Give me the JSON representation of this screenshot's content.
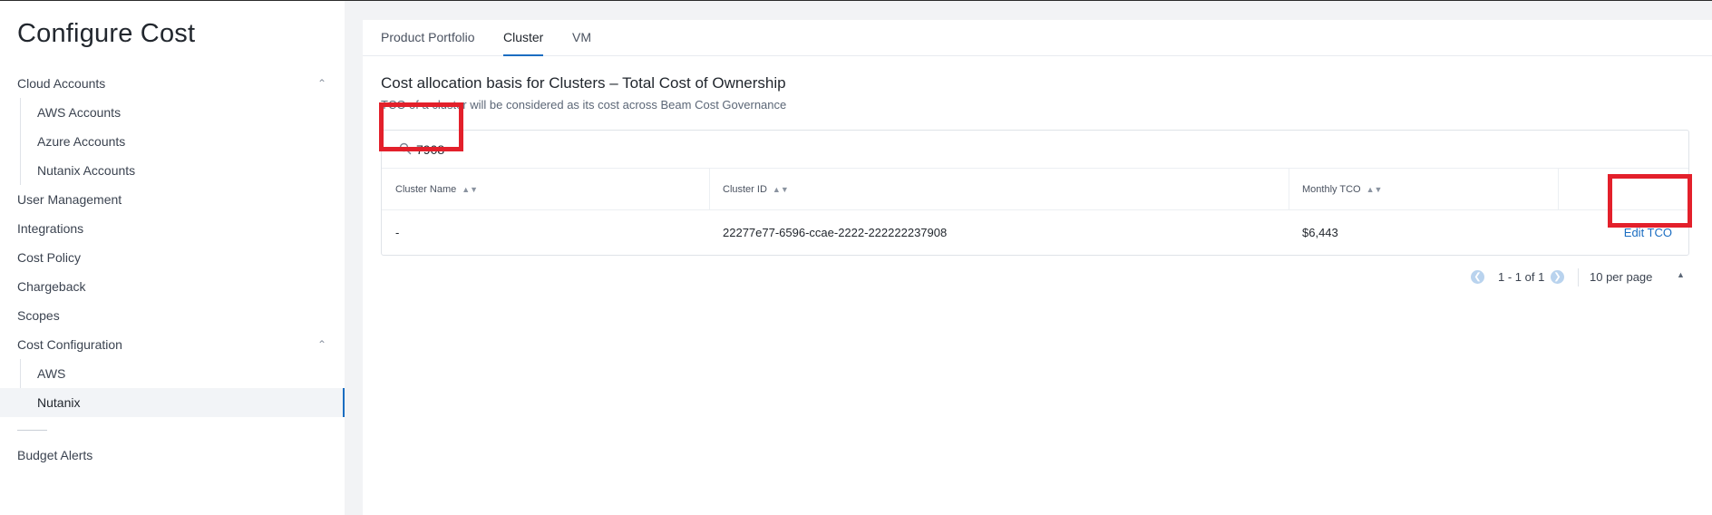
{
  "page": {
    "title": "Configure Cost"
  },
  "sidebar": {
    "groups": [
      {
        "label": "Cloud Accounts",
        "expanded": true,
        "children": [
          "AWS Accounts",
          "Azure Accounts",
          "Nutanix Accounts"
        ]
      }
    ],
    "items": [
      "User Management",
      "Integrations",
      "Cost Policy",
      "Chargeback",
      "Scopes"
    ],
    "cost_configuration": {
      "label": "Cost Configuration",
      "expanded": true,
      "children": [
        "AWS",
        "Nutanix"
      ],
      "active": "Nutanix"
    },
    "footer_item": "Budget Alerts"
  },
  "tabs": {
    "items": [
      "Product Portfolio",
      "Cluster",
      "VM"
    ],
    "active": "Cluster"
  },
  "content": {
    "heading": "Cost allocation basis for Clusters – Total Cost of Ownership",
    "subheading": "TCO of a cluster will be considered as its cost across Beam Cost Governance"
  },
  "search": {
    "value": "7908"
  },
  "table": {
    "columns": [
      "Cluster Name",
      "Cluster ID",
      "Monthly TCO"
    ],
    "rows": [
      {
        "cluster_name": "-",
        "cluster_id": "22277e77-6596-ccae-2222-222222237908",
        "monthly_tco": "$6,443",
        "action": "Edit TCO"
      }
    ]
  },
  "pagination": {
    "range": "1 - 1 of 1",
    "per_page": "10 per page"
  },
  "colors": {
    "accent": "#1b6dc1",
    "highlight": "#e3202b"
  },
  "icons": {
    "search": "search-icon",
    "sort": "sort-icon",
    "expand": "chevron-up-icon",
    "prev": "chevron-left-icon",
    "next": "chevron-right-icon"
  }
}
